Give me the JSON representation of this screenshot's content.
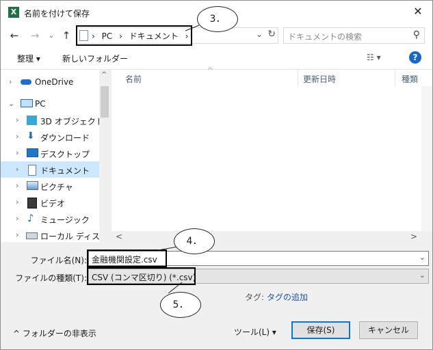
{
  "window": {
    "title": "名前を付けて保存",
    "app_icon_letter": "X",
    "close_glyph": "✕"
  },
  "nav": {
    "back_glyph": "←",
    "forward_glyph": "→",
    "recent_glyph": "⌄",
    "up_glyph": "↑",
    "breadcrumb": [
      "›",
      "PC",
      "›",
      "ドキュメント",
      "›"
    ],
    "address_dropdown_glyph": "⌄",
    "refresh_glyph": "↻",
    "search_placeholder": "ドキュメントの検索",
    "search_glyph": "⚲"
  },
  "toolbar": {
    "organize": "整理 ▾",
    "new_folder": "新しいフォルダー",
    "view_glyph": "☷ ▾",
    "help_glyph": "?"
  },
  "tree": {
    "items": [
      {
        "label": "OneDrive",
        "expander": "›",
        "icon": "cloud-icon"
      },
      {
        "label": "PC",
        "expander": "⌄",
        "icon": "pc-icon"
      },
      {
        "label": "3D オブジェクト",
        "expander": "›",
        "icon": "cube-icon"
      },
      {
        "label": "ダウンロード",
        "expander": "›",
        "icon": "download-icon"
      },
      {
        "label": "デスクトップ",
        "expander": "›",
        "icon": "desktop-icon"
      },
      {
        "label": "ドキュメント",
        "expander": "›",
        "icon": "document-icon",
        "selected": true
      },
      {
        "label": "ピクチャ",
        "expander": "›",
        "icon": "picture-icon"
      },
      {
        "label": "ビデオ",
        "expander": "›",
        "icon": "video-icon"
      },
      {
        "label": "ミュージック",
        "expander": "›",
        "icon": "music-icon"
      },
      {
        "label": "ローカル ディスク (C",
        "expander": "›",
        "icon": "drive-icon"
      }
    ],
    "scroll_up_glyph": "^"
  },
  "files": {
    "columns": [
      "名前",
      "更新日時",
      "種類"
    ],
    "sort_glyph": "^",
    "scroll_down_glyph": "⌄",
    "hscroll_left": "<",
    "hscroll_right": ">"
  },
  "form": {
    "filename_label": "ファイル名(N):",
    "filename_value": "金融機関設定.csv",
    "filetype_label": "ファイルの種類(T):",
    "filetype_value": "CSV (コンマ区切り) (*.csv)",
    "chev_glyph": "⌄",
    "tag_label": "タグ:",
    "tag_link": "タグの追加"
  },
  "footer": {
    "hide_folders": "^ フォルダーの非表示",
    "tools": "ツール(L)  ▾",
    "save": "保存(S)",
    "cancel": "キャンセル"
  },
  "callouts": [
    "3．",
    "4．",
    "5．"
  ]
}
